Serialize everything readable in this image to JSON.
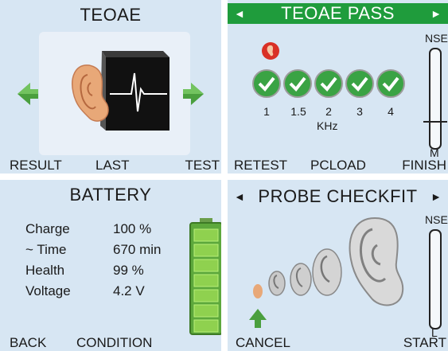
{
  "teoae": {
    "title": "TEOAE",
    "buttons": {
      "left": "RESULT",
      "center": "LAST",
      "right": "TEST"
    }
  },
  "teoae_pass": {
    "title": "TEOAE PASS",
    "frequencies": [
      "1",
      "1.5",
      "2",
      "3",
      "4"
    ],
    "unit": "KHz",
    "meter_top": "NSE",
    "meter_bottom": "M",
    "buttons": {
      "left": "RETEST",
      "center": "PCLOAD",
      "right": "FINISH"
    }
  },
  "battery": {
    "title": "BATTERY",
    "rows": [
      {
        "label": "Charge",
        "value": "100 %"
      },
      {
        "label": "~ Time",
        "value": "670 min"
      },
      {
        "label": "Health",
        "value": "99 %"
      },
      {
        "label": "Voltage",
        "value": "4.2 V"
      }
    ],
    "charge_level": 1.0,
    "buttons": {
      "left": "BACK",
      "center": "CONDITION"
    }
  },
  "probe_checkfit": {
    "title": "PROBE CHECKFIT",
    "meter_top": "NSE",
    "meter_bottom": "L",
    "buttons": {
      "left": "CANCEL",
      "right": "START"
    }
  },
  "colors": {
    "panel": "#d7e6f3",
    "accent_green": "#1f9c3c",
    "check_green": "#3aa344",
    "ear": "#e8a878"
  }
}
